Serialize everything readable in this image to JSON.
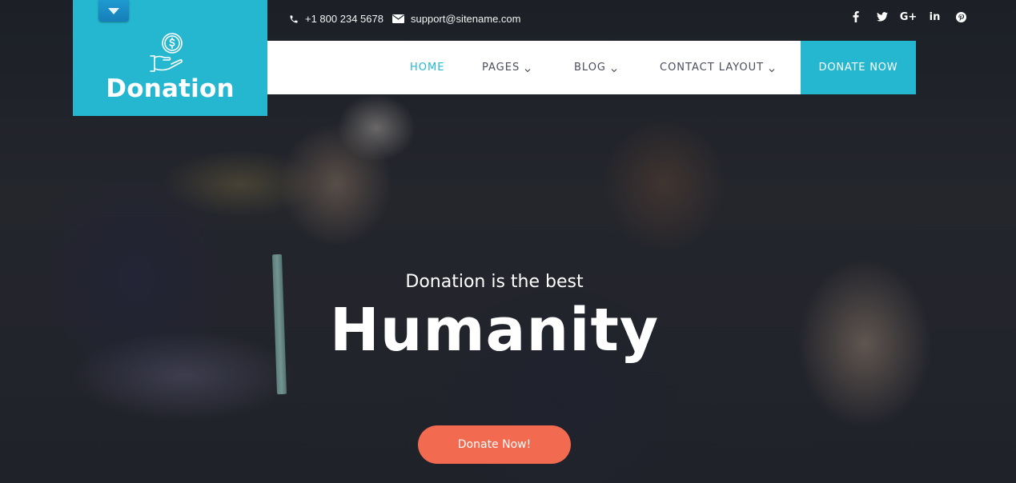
{
  "topbar": {
    "phone": "+1 800 234 5678",
    "email": "support@sitename.com",
    "phone_icon": "phone-icon",
    "email_icon": "envelope-icon",
    "socials": [
      {
        "name": "facebook",
        "glyph": "f"
      },
      {
        "name": "twitter",
        "glyph": "t"
      },
      {
        "name": "google-plus",
        "glyph": "G+"
      },
      {
        "name": "linkedin",
        "glyph": "in"
      },
      {
        "name": "pinterest",
        "glyph": "p"
      }
    ]
  },
  "logo": {
    "text": "Donation",
    "icon": "hand-coin-icon",
    "toggle_icon": "caret-down-icon"
  },
  "nav": {
    "items": [
      {
        "label": "HOME",
        "active": true,
        "dropdown": false
      },
      {
        "label": "PAGES",
        "active": false,
        "dropdown": true
      },
      {
        "label": "BLOG",
        "active": false,
        "dropdown": true
      },
      {
        "label": "CONTACT LAYOUT",
        "active": false,
        "dropdown": true
      }
    ],
    "cta_label": "DONATE NOW"
  },
  "hero": {
    "subtitle": "Donation is the best",
    "title": "Humanity",
    "button_label": "Donate Now!"
  },
  "colors": {
    "brand": "#25b7d0",
    "accent": "#f26a4f",
    "nav_text": "#4a4d5c"
  }
}
